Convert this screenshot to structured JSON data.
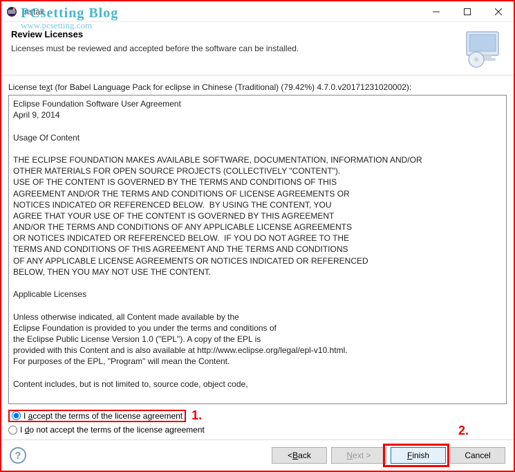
{
  "window": {
    "title": "Install"
  },
  "watermark": {
    "line1": "PCsetting Blog",
    "line2": "www.pcsetting.com"
  },
  "header": {
    "title": "Review Licenses",
    "subtitle": "Licenses must be reviewed and accepted before the software can be installed."
  },
  "license": {
    "label_prefix": "License te",
    "label_ul": "x",
    "label_suffix": "t (for Babel Language Pack for eclipse in Chinese (Traditional) (79.42%) 4.7.0.v20171231020002):",
    "text": "Eclipse Foundation Software User Agreement\nApril 9, 2014\n\nUsage Of Content\n\nTHE ECLIPSE FOUNDATION MAKES AVAILABLE SOFTWARE, DOCUMENTATION, INFORMATION AND/OR\nOTHER MATERIALS FOR OPEN SOURCE PROJECTS (COLLECTIVELY \"CONTENT\").\nUSE OF THE CONTENT IS GOVERNED BY THE TERMS AND CONDITIONS OF THIS\nAGREEMENT AND/OR THE TERMS AND CONDITIONS OF LICENSE AGREEMENTS OR\nNOTICES INDICATED OR REFERENCED BELOW.  BY USING THE CONTENT, YOU\nAGREE THAT YOUR USE OF THE CONTENT IS GOVERNED BY THIS AGREEMENT\nAND/OR THE TERMS AND CONDITIONS OF ANY APPLICABLE LICENSE AGREEMENTS\nOR NOTICES INDICATED OR REFERENCED BELOW.  IF YOU DO NOT AGREE TO THE\nTERMS AND CONDITIONS OF THIS AGREEMENT AND THE TERMS AND CONDITIONS\nOF ANY APPLICABLE LICENSE AGREEMENTS OR NOTICES INDICATED OR REFERENCED\nBELOW, THEN YOU MAY NOT USE THE CONTENT.\n\nApplicable Licenses\n\nUnless otherwise indicated, all Content made available by the\nEclipse Foundation is provided to you under the terms and conditions of\nthe Eclipse Public License Version 1.0 (\"EPL\"). A copy of the EPL is\nprovided with this Content and is also available at http://www.eclipse.org/legal/epl-v10.html.\nFor purposes of the EPL, \"Program\" will mean the Content.\n\nContent includes, but is not limited to, source code, object code,"
  },
  "radios": {
    "accept_prefix": "I ",
    "accept_ul": "a",
    "accept_suffix": "ccept the terms of the license agreement",
    "decline_prefix": "I ",
    "decline_ul": "d",
    "decline_suffix": "o not accept the terms of the license agreement"
  },
  "annotations": {
    "one": "1.",
    "two": "2."
  },
  "buttons": {
    "back_prefix": "< ",
    "back_ul": "B",
    "back_suffix": "ack",
    "next_ul": "N",
    "next_suffix": "ext >",
    "finish_ul": "F",
    "finish_suffix": "inish",
    "cancel": "Cancel"
  }
}
